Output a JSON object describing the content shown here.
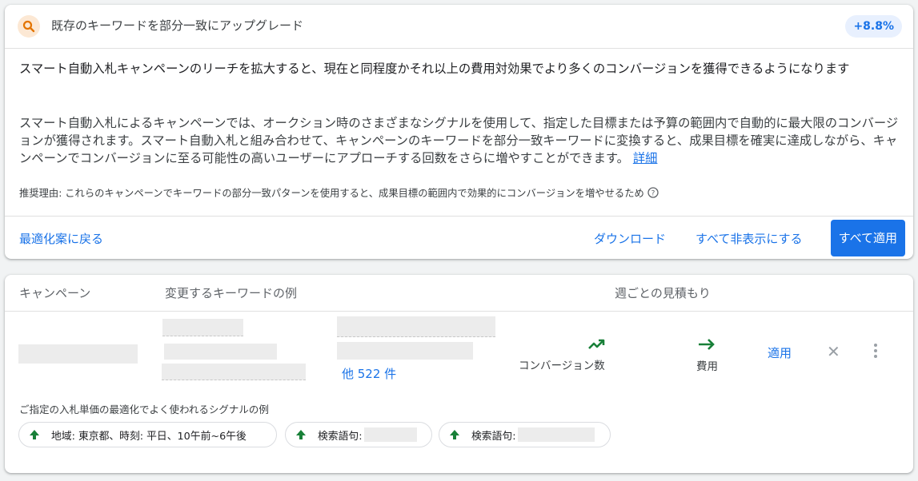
{
  "header": {
    "title": "既存のキーワードを部分一致にアップグレード",
    "badge": "+8.8%",
    "icon": "search-icon"
  },
  "body": {
    "headline": "スマート自動入札キャンペーンのリーチを拡大すると、現在と同程度かそれ以上の費用対効果でより多くのコンバージョンを獲得できるようになります",
    "description": "スマート自動入札によるキャンペーンでは、オークション時のさまざまなシグナルを使用して、指定した目標または予算の範囲内で自動的に最大限のコンバージョンが獲得されます。スマート自動入札と組み合わせて、キャンペーンのキーワードを部分一致キーワードに変換すると、成果目標を確実に達成しながら、キャンペーンでコンバージョンに至る可能性の高いユーザーにアプローチする回数をさらに増やすことができます。",
    "details_link": "詳細",
    "reason": "推奨理由: これらのキャンペーンでキーワードの部分一致パターンを使用すると、成果目標の範囲内で効果的にコンバージョンを増やせるため"
  },
  "footer": {
    "back": "最適化案に戻る",
    "download": "ダウンロード",
    "hide_all": "すべて非表示にする",
    "apply_all": "すべて適用"
  },
  "table": {
    "headers": [
      "キャンペーン",
      "変更するキーワードの例",
      "週ごとの見積もり"
    ],
    "more": "他 522 件",
    "conversions_label": "コンバージョン数",
    "cost_label": "費用",
    "apply": "適用",
    "signals_title": "ご指定の入札単価の最適化でよく使われるシグナルの例",
    "chips": [
      "地域: 東京都、時刻: 平日、10午前~6午後",
      "検索語句:",
      "検索語句:"
    ]
  },
  "colors": {
    "accent": "#1a73e8",
    "up_green": "#188038",
    "icon_bg": "#fce8d4",
    "icon_fg": "#e37400"
  }
}
